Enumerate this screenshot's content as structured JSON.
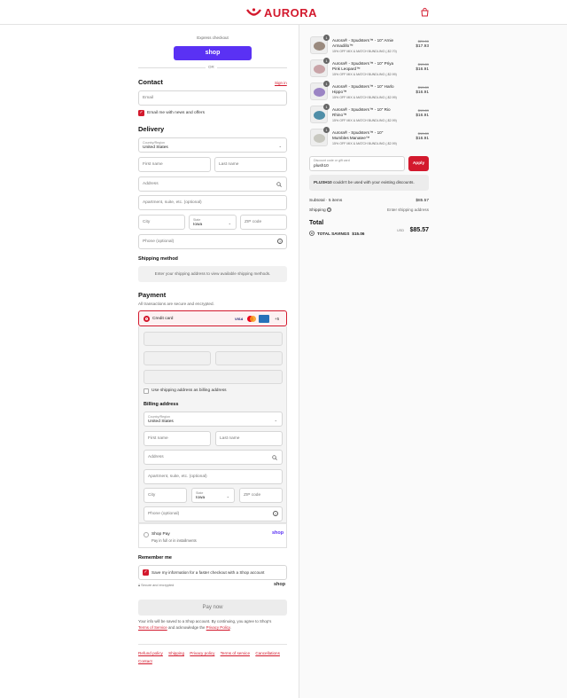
{
  "header": {
    "brand": "AURORA"
  },
  "express": {
    "title": "Express checkout",
    "shop_btn": "shop",
    "or": "OR"
  },
  "contact": {
    "title": "Contact",
    "sign_in": "Sign in",
    "email_placeholder": "Email",
    "news_label": "Email me with news and offers"
  },
  "delivery": {
    "title": "Delivery",
    "country_label": "Country/Region",
    "country": "United States",
    "first_name": "First name",
    "last_name": "Last name",
    "address": "Address",
    "apartment": "Apartment, suite, etc. (optional)",
    "city": "City",
    "state_label": "State",
    "state": "Iowa",
    "zip": "ZIP code",
    "phone": "Phone (optional)"
  },
  "shipping": {
    "title": "Shipping method",
    "notice": "Enter your shipping address to view available shipping methods."
  },
  "payment": {
    "title": "Payment",
    "subtitle": "All transactions are secure and encrypted.",
    "credit_card": "Credit card",
    "more_cards": "+5",
    "card_icons": [
      "visa",
      "mastercard",
      "amex"
    ],
    "same_address": "Use shipping address as billing address",
    "billing_title": "Billing address",
    "shop_pay": "Shop Pay",
    "shop_pay_sub": "Pay in full or in installments",
    "shop_pay_logo": "shop"
  },
  "billing": {
    "country_label": "Country/Region",
    "country": "United States",
    "first_name": "First name",
    "last_name": "Last name",
    "address": "Address",
    "apartment": "Apartment, suite, etc. (optional)",
    "city": "City",
    "state_label": "State",
    "state": "Iowa",
    "zip": "ZIP code",
    "phone": "Phone (optional)"
  },
  "remember": {
    "title": "Remember me",
    "save_label": "Save my information for a faster checkout with a Shop account",
    "secure": "Secure and encrypted",
    "shop_logo": "shop"
  },
  "pay_now": "Pay now",
  "legal": {
    "text1": "Your info will be saved to a Shop account. By continuing, you agree to Shop's",
    "terms": "Terms of Service",
    "text2": "and acknowledge the",
    "privacy": "Privacy Policy",
    "period": "."
  },
  "footer_links": [
    "Refund policy",
    "Shipping",
    "Privacy policy",
    "Terms of service",
    "Cancellations",
    "Contact"
  ],
  "cart": {
    "items": [
      {
        "qty": "1",
        "name": "Aurora® - Spudsters™ - 10\" Arnie Armadillo™",
        "discount": "15% OFF MIX & MATCH BUNDLING (-$2.70)",
        "old": "$21.00",
        "new": "$17.93",
        "color": "#9a8a7e"
      },
      {
        "qty": "1",
        "name": "Aurora® - Spudsters™ - 10\" Priya Pink Leopard™",
        "discount": "15% OFF MIX & MATCH BUNDLING (-$2.99)",
        "old": "$19.89",
        "new": "$16.91",
        "color": "#c9a4a8"
      },
      {
        "qty": "1",
        "name": "Aurora® - Spudsters™ - 10\" Harlo Hippo™",
        "discount": "15% OFF MIX & MATCH BUNDLING (-$2.99)",
        "old": "$19.89",
        "new": "$16.91",
        "color": "#9b84c4"
      },
      {
        "qty": "1",
        "name": "Aurora® - Spudsters™ - 10\" Rio Rhino™",
        "discount": "15% OFF MIX & MATCH BUNDLING (-$2.99)",
        "old": "$19.89",
        "new": "$16.91",
        "color": "#4f8ea8"
      },
      {
        "qty": "1",
        "name": "Aurora® - Spudsters™ - 10\" Mumbles Manatee™",
        "discount": "15% OFF MIX & MATCH BUNDLING (-$2.99)",
        "old": "$19.89",
        "new": "$16.91",
        "color": "#c8c8c0"
      }
    ],
    "discount_label": "Discount code or gift card",
    "discount_value": "plush10",
    "apply": "Apply",
    "error_code": "PLUSH10",
    "error_text": " couldn't be used with your existing discounts.",
    "subtotal_label": "Subtotal · 5 items",
    "subtotal": "$85.57",
    "shipping_label": "Shipping",
    "shipping_value": "Enter shipping address",
    "total_label": "Total",
    "currency": "USD",
    "total": "$85.57",
    "savings_label": "TOTAL SAVINGS",
    "savings": "$15.06"
  },
  "colors": {
    "accent": "#d3192d",
    "shop": "#5a31f4"
  }
}
